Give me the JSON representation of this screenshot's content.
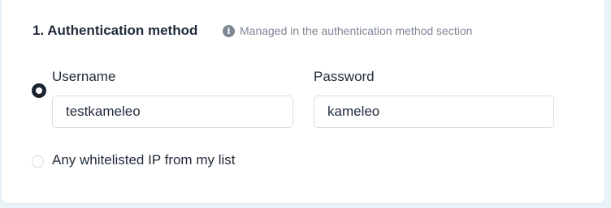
{
  "section": {
    "title": "1. Authentication method",
    "hint_icon": "info-icon",
    "hint_icon_glyph": "i",
    "hint": "Managed in the authentication method section"
  },
  "options": {
    "credentials": {
      "selected": true,
      "username_label": "Username",
      "username_value": "testkameleo",
      "password_label": "Password",
      "password_value": "kameleo"
    },
    "whitelist": {
      "selected": false,
      "label": "Any whitelisted IP from my list"
    }
  },
  "colors": {
    "page_background": "#eaf3f8",
    "card_background": "#ffffff",
    "text": "#1f2a37",
    "muted_text": "#7d8794",
    "input_border": "#d7dde3",
    "radio_selected": "#1b2530"
  }
}
